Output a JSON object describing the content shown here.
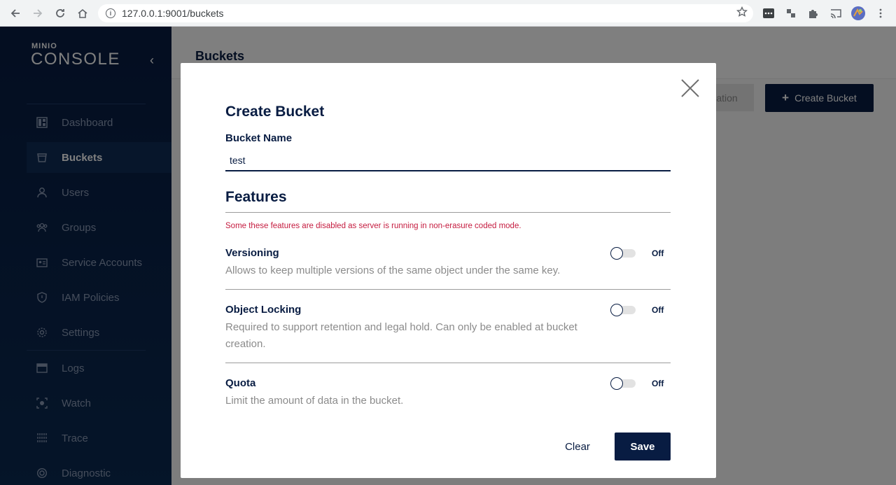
{
  "browser": {
    "url": "127.0.0.1:9001/buckets",
    "info_glyph": "i"
  },
  "sidebar": {
    "logo_top": "MINIO",
    "logo_main": "CONSOLE",
    "collapse_glyph": "‹",
    "items": [
      {
        "label": "Dashboard",
        "icon": "dashboard-icon"
      },
      {
        "label": "Buckets",
        "icon": "bucket-icon",
        "active": true
      },
      {
        "label": "Users",
        "icon": "user-icon"
      },
      {
        "label": "Groups",
        "icon": "groups-icon"
      },
      {
        "label": "Service Accounts",
        "icon": "service-accounts-icon"
      },
      {
        "label": "IAM Policies",
        "icon": "shield-icon"
      },
      {
        "label": "Settings",
        "icon": "gear-icon"
      },
      {
        "label": "Logs",
        "icon": "logs-icon"
      },
      {
        "label": "Watch",
        "icon": "watch-icon"
      },
      {
        "label": "Trace",
        "icon": "trace-icon"
      },
      {
        "label": "Diagnostic",
        "icon": "diagnostic-icon"
      }
    ]
  },
  "page": {
    "title": "Buckets",
    "replication_button": "ation",
    "create_button": "Create Bucket",
    "create_plus": "+"
  },
  "modal": {
    "title": "Create Bucket",
    "bucket_name_label": "Bucket Name",
    "bucket_name_value": "test",
    "features_title": "Features",
    "warning": "Some these features are disabled as server is running in non-erasure coded mode.",
    "features": [
      {
        "name": "Versioning",
        "desc": "Allows to keep multiple versions of the same object under the same key.",
        "state": "Off"
      },
      {
        "name": "Object Locking",
        "desc": "Required to support retention and legal hold. Can only be enabled at bucket creation.",
        "state": "Off"
      },
      {
        "name": "Quota",
        "desc": "Limit the amount of data in the bucket.",
        "state": "Off"
      }
    ],
    "clear_label": "Clear",
    "save_label": "Save"
  },
  "colors": {
    "brand": "#081c42",
    "warning": "#c51b3f"
  }
}
